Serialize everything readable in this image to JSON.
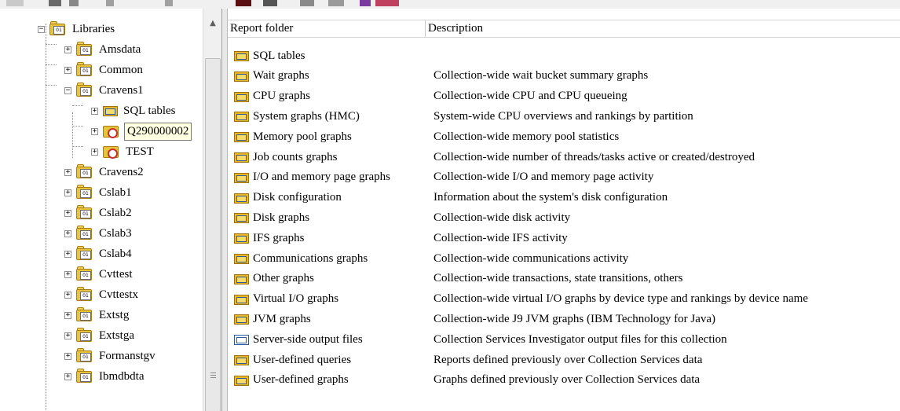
{
  "tree": {
    "root": {
      "label": "Libraries",
      "icon": "library-icon",
      "expander": "−"
    },
    "items": [
      {
        "label": "Amsdata",
        "icon": "library-icon",
        "expander": "+"
      },
      {
        "label": "Common",
        "icon": "library-icon",
        "expander": "+"
      },
      {
        "label": "Cravens1",
        "icon": "library-icon",
        "expander": "−"
      },
      {
        "label": "SQL tables",
        "icon": "folder-icon",
        "expander": "+"
      },
      {
        "label": "Q290000002",
        "icon": "collection-icon",
        "expander": "+"
      },
      {
        "label": "TEST",
        "icon": "collection-icon",
        "expander": "+"
      },
      {
        "label": "Cravens2",
        "icon": "library-icon",
        "expander": "+"
      },
      {
        "label": "Cslab1",
        "icon": "library-icon",
        "expander": "+"
      },
      {
        "label": "Cslab2",
        "icon": "library-icon",
        "expander": "+"
      },
      {
        "label": "Cslab3",
        "icon": "library-icon",
        "expander": "+"
      },
      {
        "label": "Cslab4",
        "icon": "library-icon",
        "expander": "+"
      },
      {
        "label": "Cvttest",
        "icon": "library-icon",
        "expander": "+"
      },
      {
        "label": "Cvttestx",
        "icon": "library-icon",
        "expander": "+"
      },
      {
        "label": "Extstg",
        "icon": "library-icon",
        "expander": "+"
      },
      {
        "label": "Extstga",
        "icon": "library-icon",
        "expander": "+"
      },
      {
        "label": "Formanstgv",
        "icon": "library-icon",
        "expander": "+"
      },
      {
        "label": "Ibmdbdta",
        "icon": "library-icon",
        "expander": "+"
      }
    ],
    "library_chip_text": "01",
    "scroll_up_glyph": "▲"
  },
  "list": {
    "columns": {
      "folder": "Report folder",
      "description": "Description"
    },
    "rows": [
      {
        "name": "SQL tables",
        "description": ""
      },
      {
        "name": "Wait graphs",
        "description": "Collection-wide wait bucket summary graphs"
      },
      {
        "name": "CPU graphs",
        "description": "Collection-wide CPU and CPU queueing"
      },
      {
        "name": "System graphs (HMC)",
        "description": "System-wide CPU overviews and rankings by partition"
      },
      {
        "name": "Memory pool graphs",
        "description": "Collection-wide memory pool statistics"
      },
      {
        "name": "Job counts graphs",
        "description": "Collection-wide number of threads/tasks active or created/destroyed"
      },
      {
        "name": "I/O and memory page graphs",
        "description": "Collection-wide I/O and memory page activity"
      },
      {
        "name": "Disk configuration",
        "description": "Information about the system's disk configuration"
      },
      {
        "name": "Disk graphs",
        "description": "Collection-wide disk activity"
      },
      {
        "name": "IFS graphs",
        "description": "Collection-wide IFS activity"
      },
      {
        "name": "Communications graphs",
        "description": "Collection-wide communications activity"
      },
      {
        "name": "Other graphs",
        "description": "Collection-wide transactions, state transitions, others"
      },
      {
        "name": "Virtual I/O graphs",
        "description": "Collection-wide virtual I/O graphs by device type and rankings by device name"
      },
      {
        "name": "JVM graphs",
        "description": "Collection-wide J9 JVM graphs (IBM Technology for Java)"
      },
      {
        "name": "Server-side output files",
        "description": "Collection Services Investigator output files for this collection"
      },
      {
        "name": "User-defined queries",
        "description": "Reports defined previously over Collection Services data"
      },
      {
        "name": "User-defined graphs",
        "description": "Graphs defined previously over Collection Services data"
      }
    ]
  },
  "colors": {
    "folder": "#e9b824",
    "collection_clock": "#c83030",
    "selection_bg": "#ffffe1"
  }
}
